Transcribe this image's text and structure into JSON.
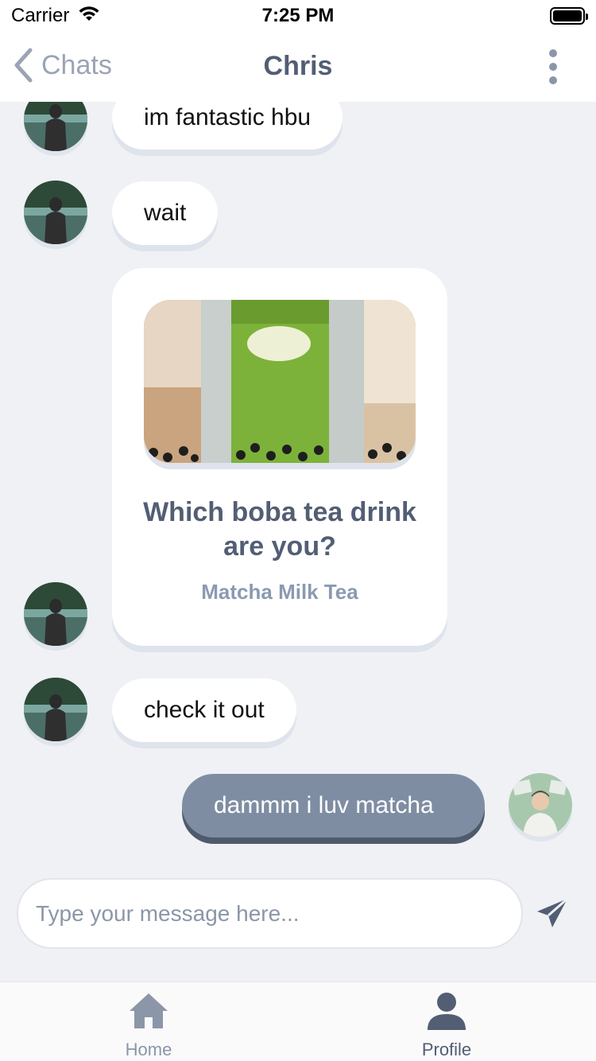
{
  "status_bar": {
    "carrier": "Carrier",
    "time": "7:25 PM"
  },
  "nav": {
    "back_label": "Chats",
    "title": "Chris"
  },
  "messages": [
    {
      "sender": "other",
      "text": "im fantastic hbu"
    },
    {
      "sender": "other",
      "text": "wait"
    },
    {
      "sender": "other",
      "type": "card",
      "title": "Which boba tea drink are you?",
      "subtitle": "Matcha Milk Tea"
    },
    {
      "sender": "other",
      "text": "check it out"
    },
    {
      "sender": "me",
      "text": "dammm i luv matcha"
    }
  ],
  "composer": {
    "placeholder": "Type your message here...",
    "value": ""
  },
  "tabs": [
    {
      "label": "Home",
      "icon": "home-icon",
      "active": false
    },
    {
      "label": "Profile",
      "icon": "person-icon",
      "active": true
    }
  ],
  "colors": {
    "accent": "#525e74",
    "my_bubble": "#7f8da3",
    "background": "#eff1f5"
  }
}
